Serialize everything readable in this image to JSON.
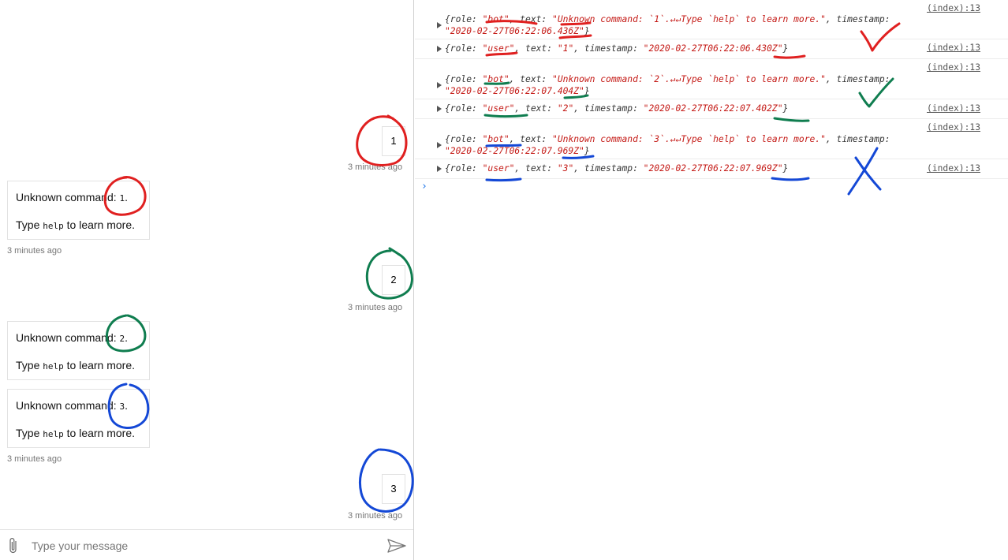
{
  "chat": {
    "messages": [
      {
        "role": "user",
        "text": "1",
        "time": "3 minutes ago"
      },
      {
        "role": "bot",
        "line1_prefix": "Unknown command: ",
        "code": "1",
        "line1_suffix": ".",
        "line2_prefix": "Type ",
        "line2_code": "help",
        "line2_suffix": " to learn more.",
        "time": "3 minutes ago"
      },
      {
        "role": "user",
        "text": "2",
        "time": "3 minutes ago"
      },
      {
        "role": "bot",
        "line1_prefix": "Unknown command: ",
        "code": "2",
        "line1_suffix": ".",
        "line2_prefix": "Type ",
        "line2_code": "help",
        "line2_suffix": " to learn more."
      },
      {
        "role": "bot",
        "line1_prefix": "Unknown command: ",
        "code": "3",
        "line1_suffix": ".",
        "line2_prefix": "Type ",
        "line2_code": "help",
        "line2_suffix": " to learn more.",
        "time": "3 minutes ago"
      },
      {
        "role": "user",
        "text": "3",
        "time": "3 minutes ago"
      }
    ],
    "composer": {
      "placeholder": "Type your message",
      "attach_icon": "paperclip-icon",
      "send_icon": "send-icon"
    }
  },
  "console": {
    "source": "(index):13",
    "entries": [
      {
        "k1": "{role: ",
        "role": "\"bot\"",
        "k2": ", text: ",
        "text": "\"Unknown command: `1`.↵↵Type `help` to learn more.\"",
        "k3": ", timestamp:",
        "timestamp": "\"2020-02-27T06:22:06.436Z\"",
        "end": "}"
      },
      {
        "k1": "{role: ",
        "role": "\"user\"",
        "k2": ", text: ",
        "text": "\"1\"",
        "k3": ", timestamp: ",
        "timestamp": "\"2020-02-27T06:22:06.430Z\"",
        "end": "}"
      },
      {
        "k1": "{role: ",
        "role": "\"bot\"",
        "k2": ", text: ",
        "text": "\"Unknown command: `2`.↵↵Type `help` to learn more.\"",
        "k3": ", timestamp:",
        "timestamp": "\"2020-02-27T06:22:07.404Z\"",
        "end": "}"
      },
      {
        "k1": "{role: ",
        "role": "\"user\"",
        "k2": ", text: ",
        "text": "\"2\"",
        "k3": ", timestamp: ",
        "timestamp": "\"2020-02-27T06:22:07.402Z\"",
        "end": "}"
      },
      {
        "k1": "{role: ",
        "role": "\"bot\"",
        "k2": ", text: ",
        "text": "\"Unknown command: `3`.↵↵Type `help` to learn more.\"",
        "k3": ", timestamp:",
        "timestamp": "\"2020-02-27T06:22:07.969Z\"",
        "end": "}"
      },
      {
        "k1": "{role: ",
        "role": "\"user\"",
        "k2": ", text: ",
        "text": "\"3\"",
        "k3": ", timestamp: ",
        "timestamp": "\"2020-02-27T06:22:07.969Z\"",
        "end": "}"
      }
    ],
    "prompt": "›"
  },
  "colors": {
    "red": "#e02020",
    "green": "#0f7d4f",
    "blue": "#1448d6",
    "string": "#c41a16",
    "prompt": "#1a73e8"
  }
}
